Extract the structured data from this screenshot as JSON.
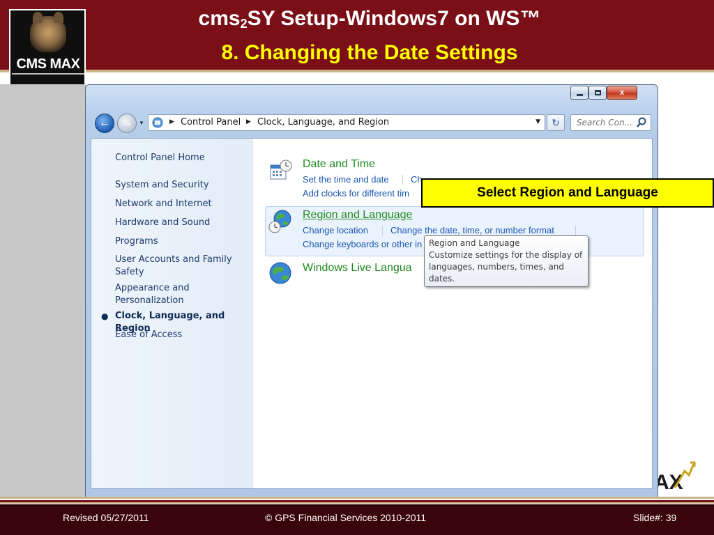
{
  "slide": {
    "title_main": "cms",
    "title_sub": "2",
    "title_rest": "SY Setup-Windows7 on WS™",
    "subtitle": "8. Changing the Date Settings",
    "logo_text": "CMS MAX",
    "footer_revised": "Revised  05/27/2011",
    "footer_copyright": "© GPS Financial Services 2010-2011",
    "footer_slide": "Slide#: 39",
    "accent_color": "#7a0f17",
    "subtitle_color": "#ffff00"
  },
  "window": {
    "controls": {
      "minimize": "minimize",
      "maximize": "maximize",
      "close": "x"
    },
    "address_bar": {
      "segments": [
        "Control Panel",
        "Clock, Language, and Region"
      ]
    },
    "search": {
      "placeholder": "Search Con..."
    }
  },
  "sidebar": {
    "items": [
      {
        "label": "Control Panel Home"
      },
      {
        "label": "System and Security"
      },
      {
        "label": "Network and Internet"
      },
      {
        "label": "Hardware and Sound"
      },
      {
        "label": "Programs"
      },
      {
        "label": "User Accounts and Family Safety"
      },
      {
        "label": "Appearance and Personalization"
      },
      {
        "label": "Clock, Language, and Region",
        "current": true
      },
      {
        "label": "Ease of Access"
      }
    ]
  },
  "categories": [
    {
      "title": "Date and Time",
      "icon": "calendar-clock-icon",
      "links": [
        "Set the time and date",
        "Ch",
        "Add clocks for different tim"
      ]
    },
    {
      "title": "Region and Language",
      "icon": "globe-clock-icon",
      "links": [
        "Change location",
        "Change the date, time, or number format",
        "Change keyboards or other in"
      ]
    },
    {
      "title": "Windows Live Langua",
      "icon": "globe-icon",
      "links": []
    }
  ],
  "tooltip": {
    "title": "Region and Language",
    "body": "Customize settings for the display of languages, numbers, times, and dates."
  },
  "callout": {
    "text": "Select Region and Language",
    "color": "#ffff00"
  }
}
